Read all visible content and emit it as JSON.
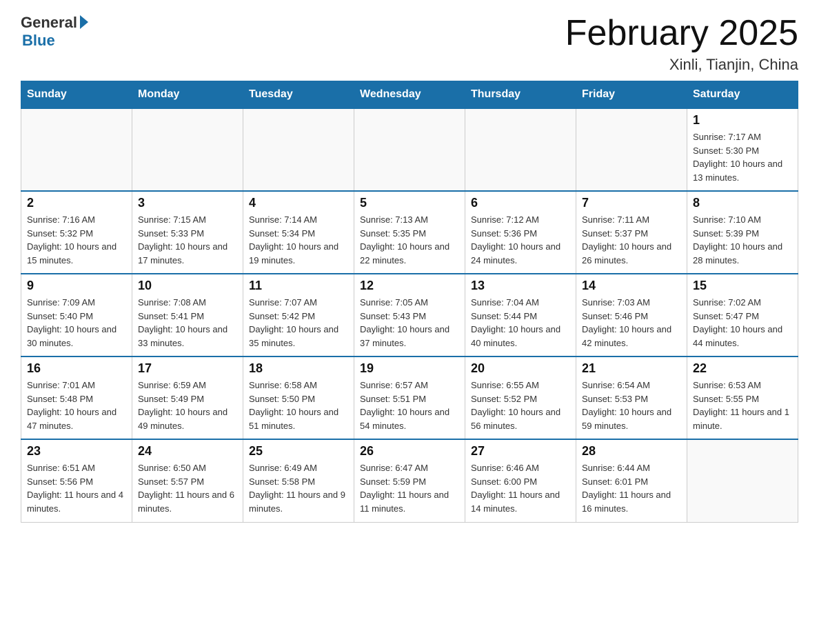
{
  "header": {
    "logo_general": "General",
    "logo_blue": "Blue",
    "month_title": "February 2025",
    "location": "Xinli, Tianjin, China"
  },
  "days_of_week": [
    "Sunday",
    "Monday",
    "Tuesday",
    "Wednesday",
    "Thursday",
    "Friday",
    "Saturday"
  ],
  "weeks": [
    [
      {
        "day": "",
        "info": ""
      },
      {
        "day": "",
        "info": ""
      },
      {
        "day": "",
        "info": ""
      },
      {
        "day": "",
        "info": ""
      },
      {
        "day": "",
        "info": ""
      },
      {
        "day": "",
        "info": ""
      },
      {
        "day": "1",
        "info": "Sunrise: 7:17 AM\nSunset: 5:30 PM\nDaylight: 10 hours and 13 minutes."
      }
    ],
    [
      {
        "day": "2",
        "info": "Sunrise: 7:16 AM\nSunset: 5:32 PM\nDaylight: 10 hours and 15 minutes."
      },
      {
        "day": "3",
        "info": "Sunrise: 7:15 AM\nSunset: 5:33 PM\nDaylight: 10 hours and 17 minutes."
      },
      {
        "day": "4",
        "info": "Sunrise: 7:14 AM\nSunset: 5:34 PM\nDaylight: 10 hours and 19 minutes."
      },
      {
        "day": "5",
        "info": "Sunrise: 7:13 AM\nSunset: 5:35 PM\nDaylight: 10 hours and 22 minutes."
      },
      {
        "day": "6",
        "info": "Sunrise: 7:12 AM\nSunset: 5:36 PM\nDaylight: 10 hours and 24 minutes."
      },
      {
        "day": "7",
        "info": "Sunrise: 7:11 AM\nSunset: 5:37 PM\nDaylight: 10 hours and 26 minutes."
      },
      {
        "day": "8",
        "info": "Sunrise: 7:10 AM\nSunset: 5:39 PM\nDaylight: 10 hours and 28 minutes."
      }
    ],
    [
      {
        "day": "9",
        "info": "Sunrise: 7:09 AM\nSunset: 5:40 PM\nDaylight: 10 hours and 30 minutes."
      },
      {
        "day": "10",
        "info": "Sunrise: 7:08 AM\nSunset: 5:41 PM\nDaylight: 10 hours and 33 minutes."
      },
      {
        "day": "11",
        "info": "Sunrise: 7:07 AM\nSunset: 5:42 PM\nDaylight: 10 hours and 35 minutes."
      },
      {
        "day": "12",
        "info": "Sunrise: 7:05 AM\nSunset: 5:43 PM\nDaylight: 10 hours and 37 minutes."
      },
      {
        "day": "13",
        "info": "Sunrise: 7:04 AM\nSunset: 5:44 PM\nDaylight: 10 hours and 40 minutes."
      },
      {
        "day": "14",
        "info": "Sunrise: 7:03 AM\nSunset: 5:46 PM\nDaylight: 10 hours and 42 minutes."
      },
      {
        "day": "15",
        "info": "Sunrise: 7:02 AM\nSunset: 5:47 PM\nDaylight: 10 hours and 44 minutes."
      }
    ],
    [
      {
        "day": "16",
        "info": "Sunrise: 7:01 AM\nSunset: 5:48 PM\nDaylight: 10 hours and 47 minutes."
      },
      {
        "day": "17",
        "info": "Sunrise: 6:59 AM\nSunset: 5:49 PM\nDaylight: 10 hours and 49 minutes."
      },
      {
        "day": "18",
        "info": "Sunrise: 6:58 AM\nSunset: 5:50 PM\nDaylight: 10 hours and 51 minutes."
      },
      {
        "day": "19",
        "info": "Sunrise: 6:57 AM\nSunset: 5:51 PM\nDaylight: 10 hours and 54 minutes."
      },
      {
        "day": "20",
        "info": "Sunrise: 6:55 AM\nSunset: 5:52 PM\nDaylight: 10 hours and 56 minutes."
      },
      {
        "day": "21",
        "info": "Sunrise: 6:54 AM\nSunset: 5:53 PM\nDaylight: 10 hours and 59 minutes."
      },
      {
        "day": "22",
        "info": "Sunrise: 6:53 AM\nSunset: 5:55 PM\nDaylight: 11 hours and 1 minute."
      }
    ],
    [
      {
        "day": "23",
        "info": "Sunrise: 6:51 AM\nSunset: 5:56 PM\nDaylight: 11 hours and 4 minutes."
      },
      {
        "day": "24",
        "info": "Sunrise: 6:50 AM\nSunset: 5:57 PM\nDaylight: 11 hours and 6 minutes."
      },
      {
        "day": "25",
        "info": "Sunrise: 6:49 AM\nSunset: 5:58 PM\nDaylight: 11 hours and 9 minutes."
      },
      {
        "day": "26",
        "info": "Sunrise: 6:47 AM\nSunset: 5:59 PM\nDaylight: 11 hours and 11 minutes."
      },
      {
        "day": "27",
        "info": "Sunrise: 6:46 AM\nSunset: 6:00 PM\nDaylight: 11 hours and 14 minutes."
      },
      {
        "day": "28",
        "info": "Sunrise: 6:44 AM\nSunset: 6:01 PM\nDaylight: 11 hours and 16 minutes."
      },
      {
        "day": "",
        "info": ""
      }
    ]
  ]
}
